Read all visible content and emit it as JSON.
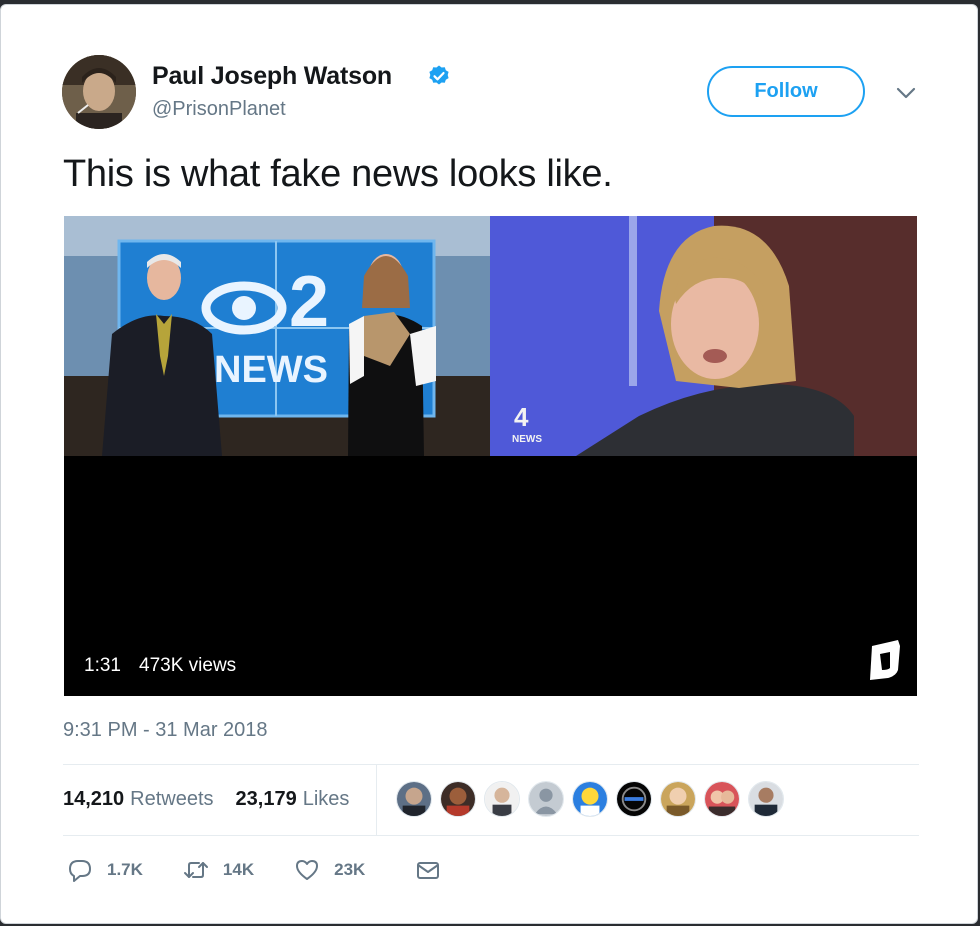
{
  "author": {
    "name": "Paul Joseph Watson",
    "handle": "@PrisonPlanet",
    "verified": true,
    "avatar_icon": "user-avatar"
  },
  "follow_label": "Follow",
  "tweet_text": "This is what fake news looks like.",
  "media": {
    "duration": "1:31",
    "views": "473K views",
    "left_frame_logo_text": "2 NEWS",
    "right_frame_logo_text": "4 NEWS",
    "brand_icon": "daily-wire-logo"
  },
  "timestamp": "9:31 PM - 31 Mar 2018",
  "stats": {
    "retweets_count": "14,210",
    "retweets_label": "Retweets",
    "likes_count": "23,179",
    "likes_label": "Likes"
  },
  "actions": {
    "replies": "1.7K",
    "retweets": "14K",
    "likes": "23K"
  },
  "colors": {
    "accent": "#1da1f2",
    "muted": "#657786",
    "text": "#14171a"
  }
}
